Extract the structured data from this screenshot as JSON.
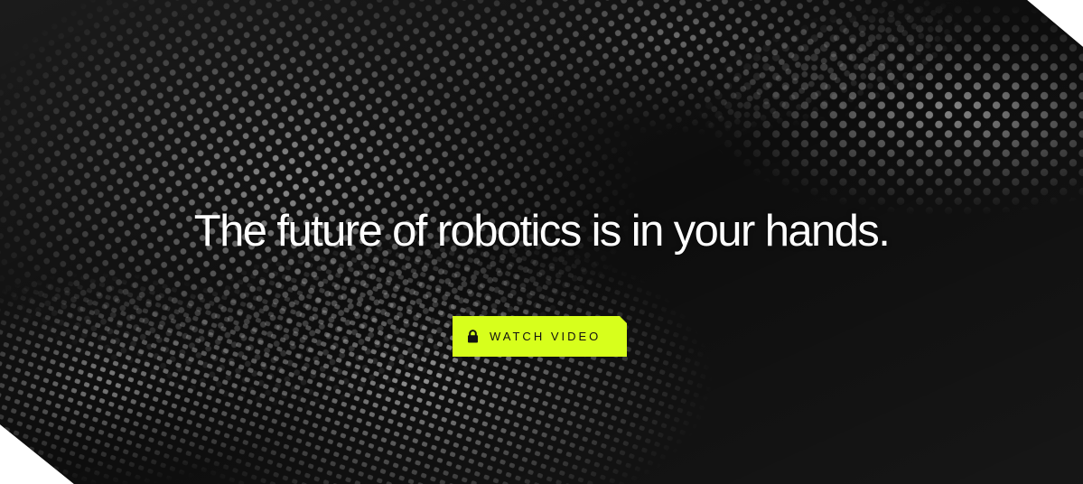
{
  "hero": {
    "headline": "The future of robotics is in your hands.",
    "cta_label": "WATCH VIDEO",
    "cta_icon": "lock-icon",
    "accent_color": "#d7ff1c",
    "background_color": "#0d0d0d"
  }
}
